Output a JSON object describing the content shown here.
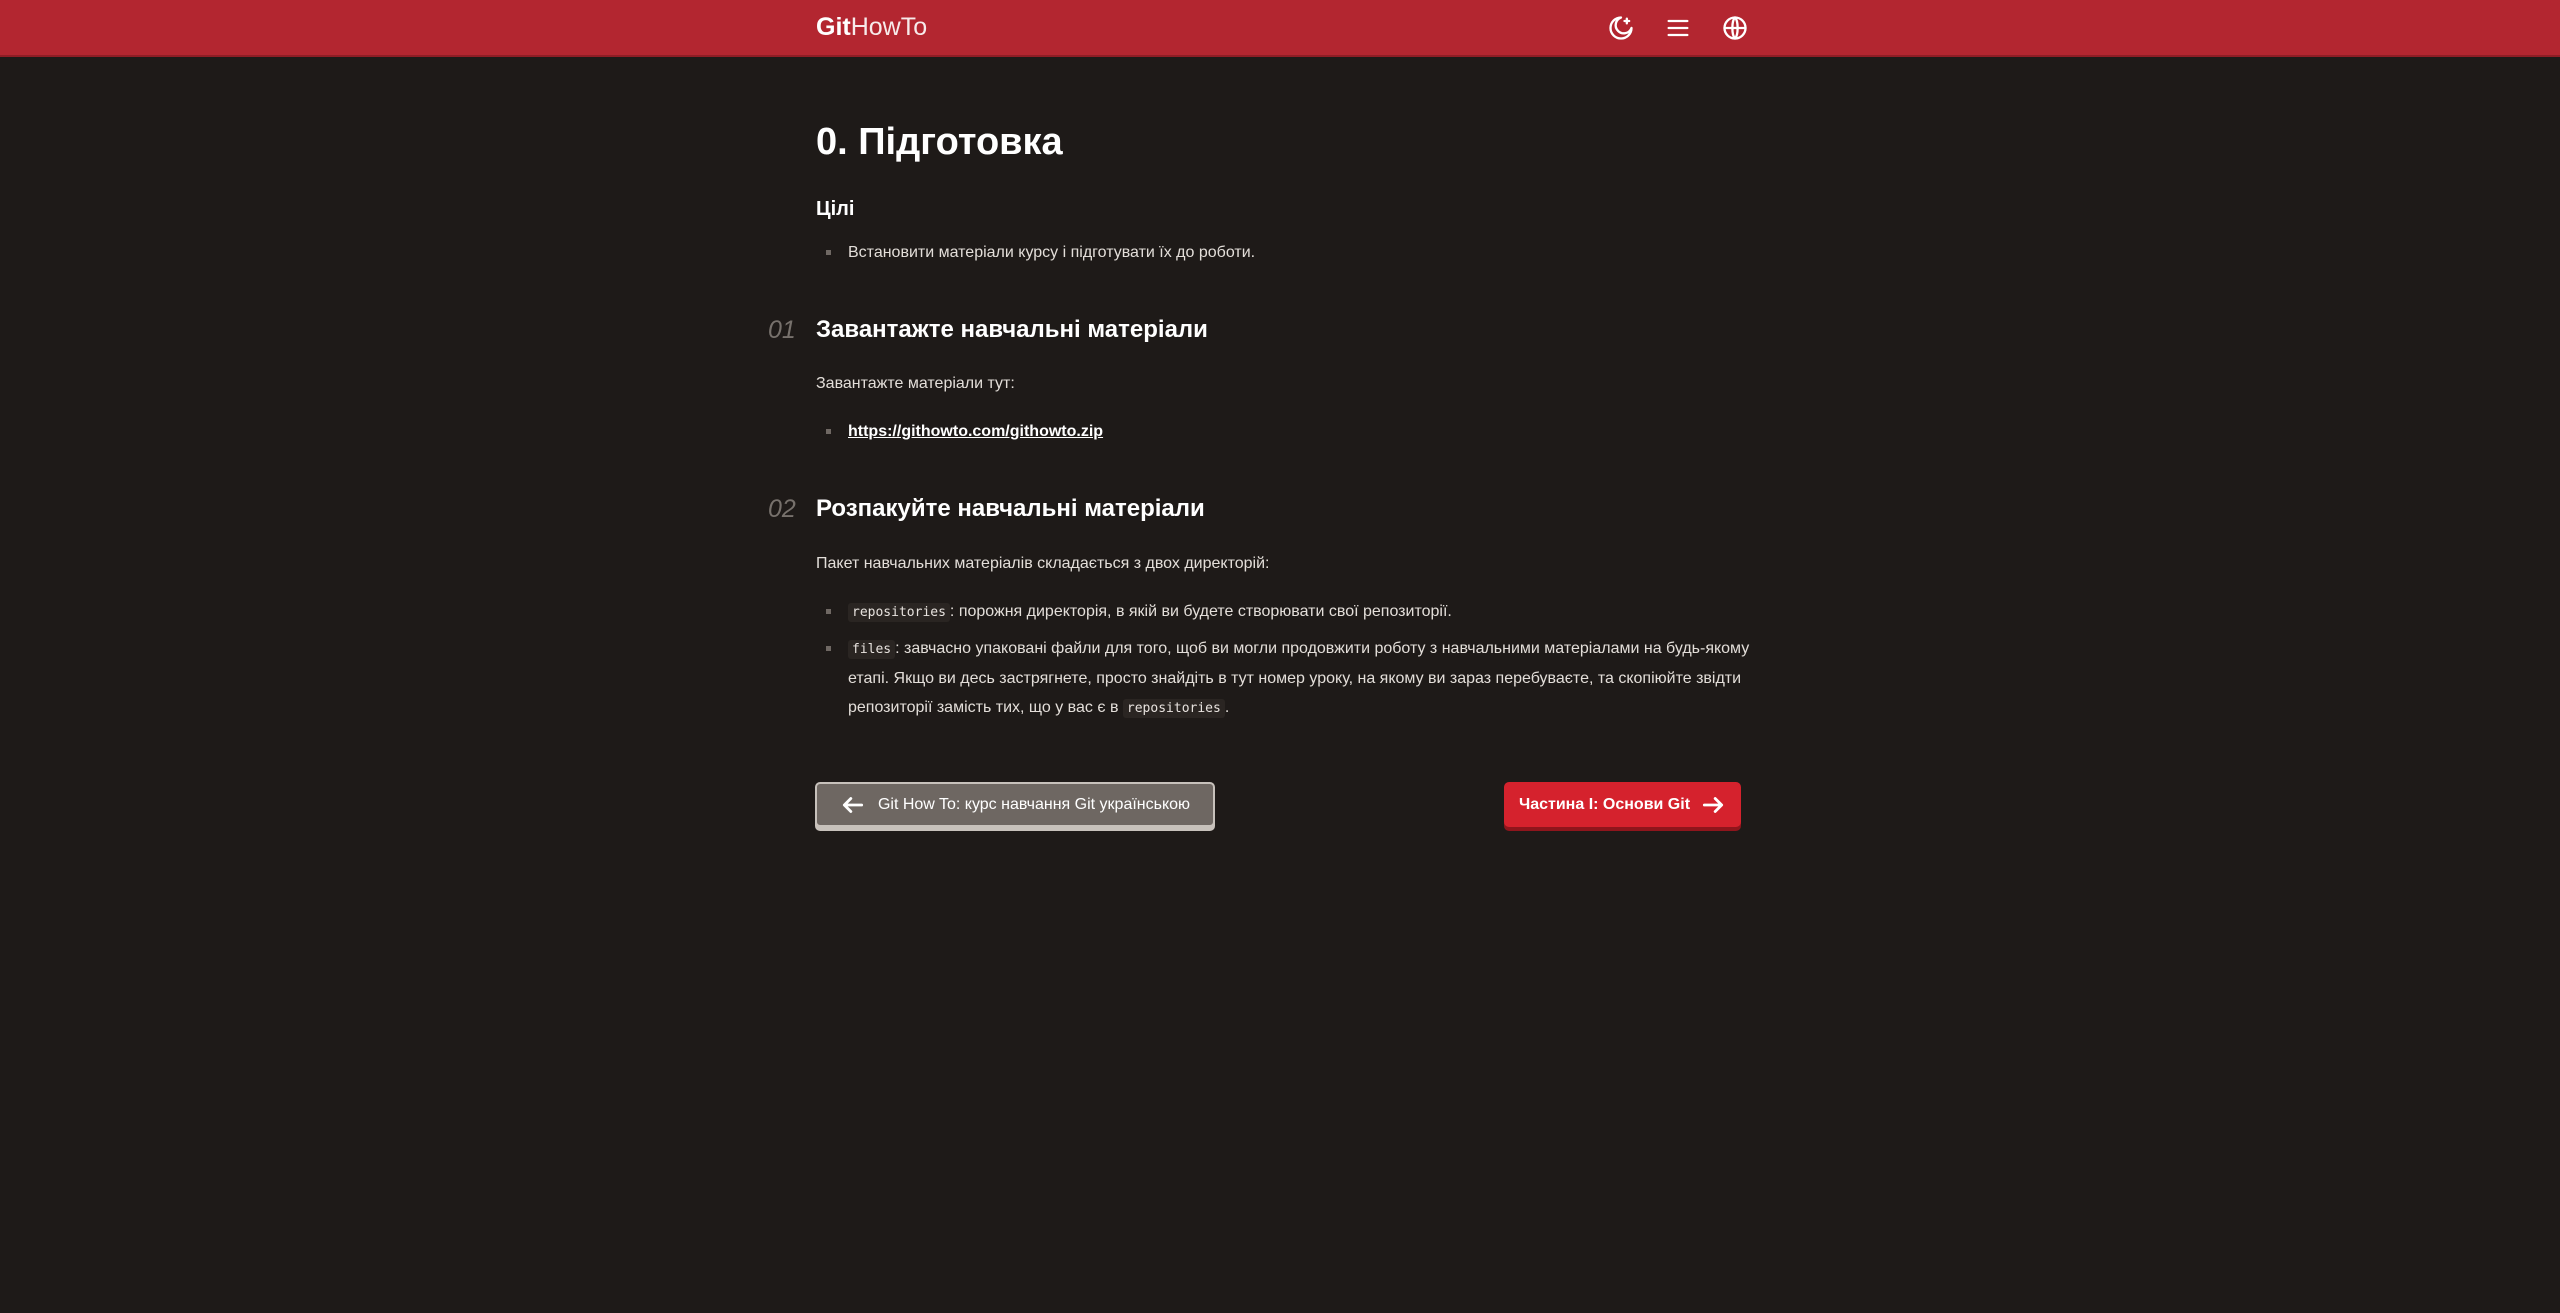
{
  "header": {
    "logo_bold": "Git",
    "logo_light": "HowTo",
    "icons": [
      "theme-toggle-icon",
      "menu-icon",
      "language-icon"
    ]
  },
  "page": {
    "title": "0. Підготовка",
    "goals_title": "Цілі",
    "goals": [
      "Встановити матеріали курсу і підготувати їх до роботи."
    ]
  },
  "steps": [
    {
      "num": "01",
      "title": "Завантажте навчальні матеріали",
      "text": "Завантажте матеріали тут:",
      "link": "https://githowto.com/githowto.zip"
    },
    {
      "num": "02",
      "title": "Розпакуйте навчальні матеріали",
      "text": "Пакет навчальних матеріалів складається з двох директорій:",
      "items": [
        {
          "code": "repositories",
          "text": ": порожня директорія, в якій ви будете створювати свої репозиторії."
        },
        {
          "code": "files",
          "text": ": завчасно упаковані файли для того, щоб ви могли продовжити роботу з навчальними матеріалами на будь-якому етапі. Якщо ви десь застрягнете, просто знайдіть в тут номер уроку, на якому ви зараз перебуваєте, та скопіюйте звідти репозиторії замість тих, що у вас є в",
          "code2": "repositories",
          "tail": "."
        }
      ]
    }
  ],
  "nav": {
    "prev_label": "Git How To: курс навчання Git українською",
    "next_label": "Частина I: Основи Git"
  },
  "colors": {
    "header_bg": "#b32630",
    "page_bg": "#1e1a18",
    "next_button": "#d5222d",
    "prev_button": "#6e6762"
  }
}
